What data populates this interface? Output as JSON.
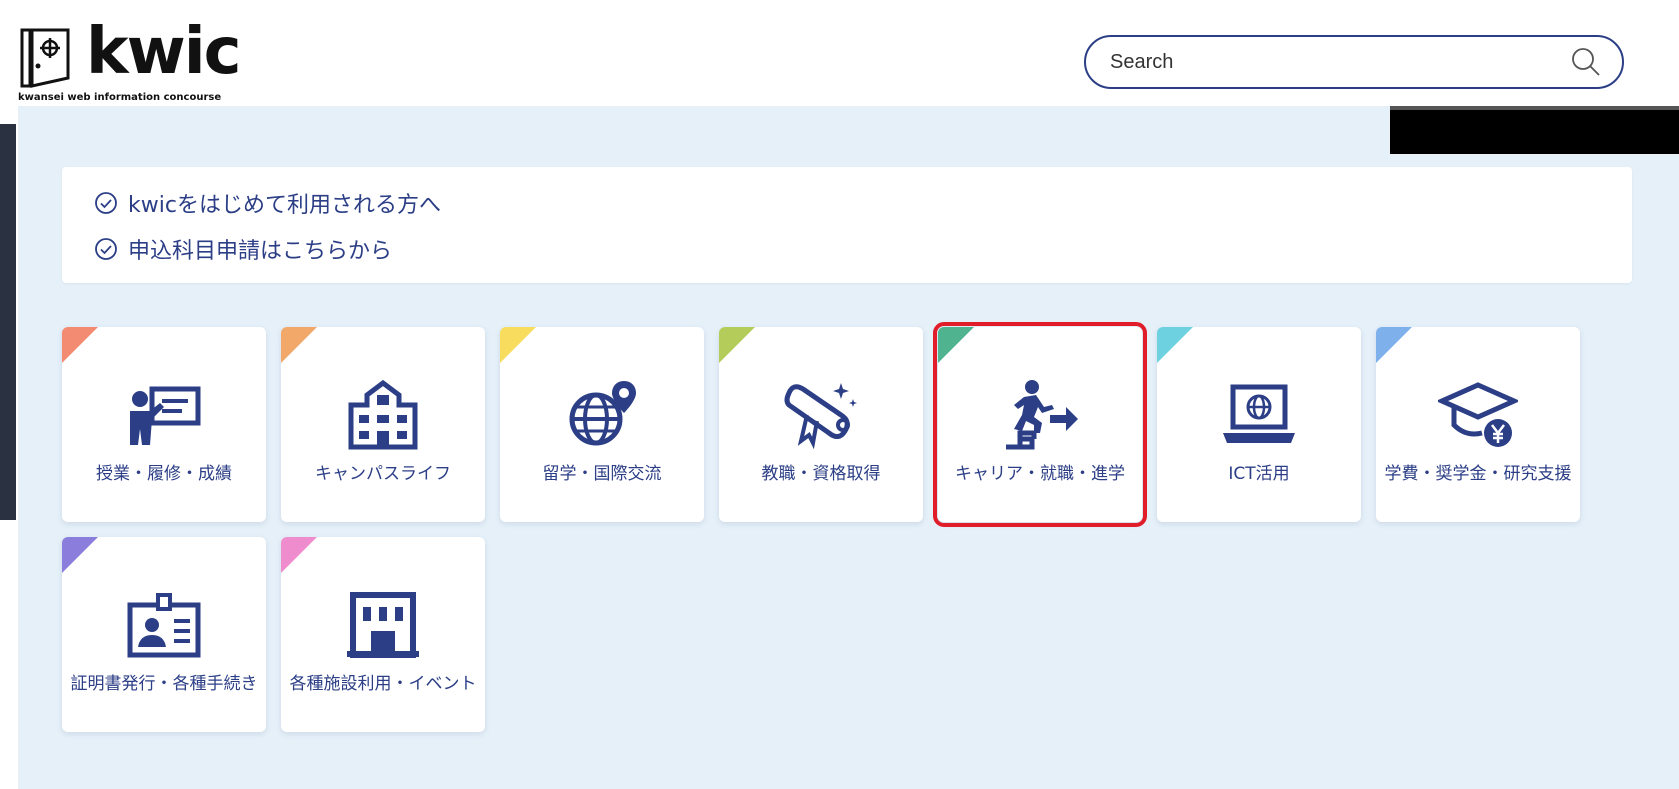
{
  "header": {
    "logo_text": "kwic",
    "logo_tagline": "kwansei web information concourse",
    "search_placeholder": "Search"
  },
  "notices": [
    "kwicをはじめて利用される方へ",
    "申込科目申請はこちらから"
  ],
  "tiles": [
    {
      "label": "授業・履修・成績",
      "icon": "lecture-icon",
      "color": "#f28b72"
    },
    {
      "label": "キャンパスライフ",
      "icon": "school-building-icon",
      "color": "#f2a868"
    },
    {
      "label": "留学・国際交流",
      "icon": "globe-pin-icon",
      "color": "#f7dc5d"
    },
    {
      "label": "教職・資格取得",
      "icon": "diploma-icon",
      "color": "#b3cc5a"
    },
    {
      "label": "キャリア・就職・進学",
      "icon": "career-stairs-icon",
      "color": "#4fb38f"
    },
    {
      "label": "ICT活用",
      "icon": "laptop-icon",
      "color": "#6ed1df"
    },
    {
      "label": "学費・奨学金・研究支援",
      "icon": "graduation-cap-yen-icon",
      "color": "#7eb0ec"
    },
    {
      "label": "証明書発行・各種手続き",
      "icon": "id-card-icon",
      "color": "#8a7ddc"
    },
    {
      "label": "各種施設利用・イベント",
      "icon": "facility-icon",
      "color": "#ef8ccd"
    }
  ],
  "theme": {
    "navy": "#2b3e86",
    "background": "#e5f0f9",
    "highlight": "#e21d2a"
  }
}
